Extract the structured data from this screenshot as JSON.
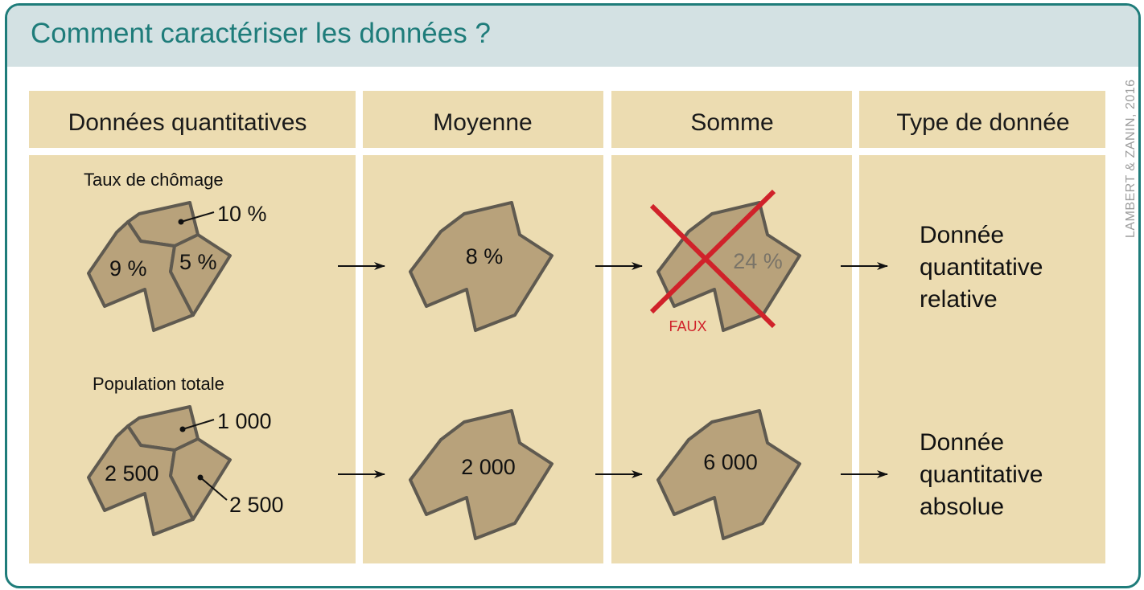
{
  "title": "Comment caractériser les données ?",
  "credit": "LAMBERT & ZANIN, 2016",
  "columns": [
    "Données quantitatives",
    "Moyenne",
    "Somme",
    "Type de donnée"
  ],
  "row1": {
    "caption": "Taux de chômage",
    "values": [
      "10 %",
      "9 %",
      "5 %"
    ],
    "mean": "8 %",
    "sum": "24 %",
    "sum_flag": "FAUX",
    "type_lines": [
      "Donnée",
      "quantitative",
      "relative"
    ]
  },
  "row2": {
    "caption": "Population totale",
    "values": [
      "1 000",
      "2 500",
      "2 500"
    ],
    "mean": "2 000",
    "sum": "6 000",
    "type_lines": [
      "Donnée",
      "quantitative",
      "absolue"
    ]
  },
  "colors": {
    "frame": "#1e7c7a",
    "title_bar": "#d3e1e3",
    "panel": "#ecdcb1",
    "shape_fill": "#b8a27b",
    "shape_stroke": "#5f5a50",
    "cross": "#d0222a"
  }
}
